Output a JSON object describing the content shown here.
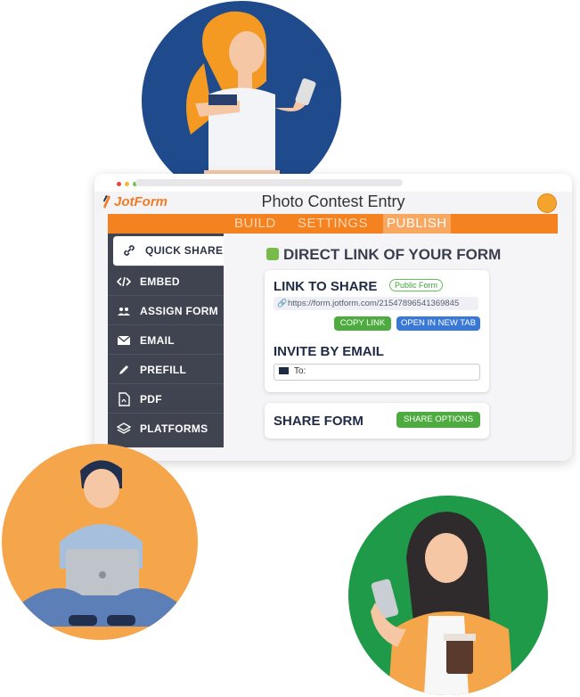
{
  "window": {
    "logo_text": "JotForm",
    "form_title": "Photo Contest Entry"
  },
  "tabs": [
    {
      "label": "BUILD"
    },
    {
      "label": "SETTINGS"
    },
    {
      "label": "PUBLISH"
    }
  ],
  "sidebar": {
    "items": [
      {
        "label": "QUICK SHARE",
        "icon": "link-icon"
      },
      {
        "label": "EMBED",
        "icon": "code-icon"
      },
      {
        "label": "ASSIGN FORM",
        "icon": "users-icon"
      },
      {
        "label": "EMAIL",
        "icon": "envelope-icon"
      },
      {
        "label": "PREFILL",
        "icon": "pen-icon"
      },
      {
        "label": "PDF",
        "icon": "pdf-icon"
      },
      {
        "label": "PLATFORMS",
        "icon": "layers-icon"
      }
    ]
  },
  "main": {
    "heading": "DIRECT LINK OF YOUR FORM",
    "link_card": {
      "title": "LINK TO SHARE",
      "badge": "Public Form",
      "url": "https://form.jotform.com/21547896541369845",
      "copy_label": "COPY LINK",
      "open_label": "OPEN IN NEW TAB",
      "invite_title": "INVITE BY EMAIL",
      "to_label": "To:"
    },
    "share_card": {
      "title": "SHARE FORM",
      "button_label": "SHARE OPTIONS"
    }
  },
  "colors": {
    "accent_orange": "#f58220",
    "sidebar_bg": "#3f4450",
    "green_button": "#4dab3f",
    "blue_button": "#3a78d6",
    "circle_blue": "#1f4a8c",
    "circle_orange": "#f5a54a",
    "circle_green": "#1f9a48"
  }
}
